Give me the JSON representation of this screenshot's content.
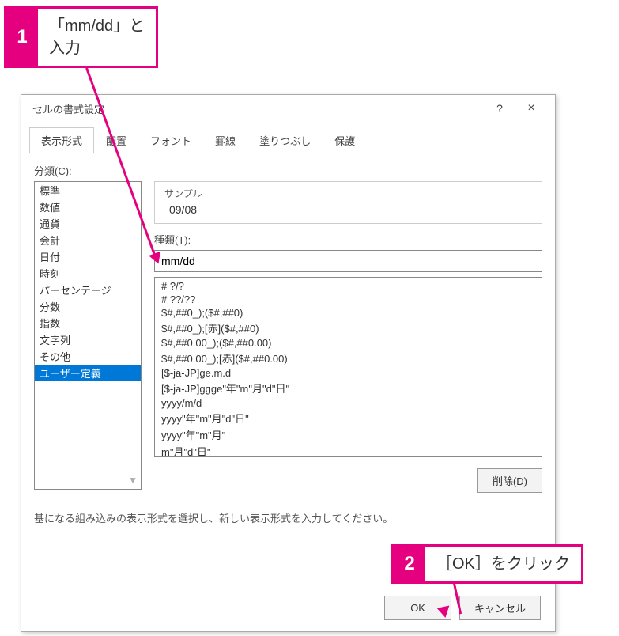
{
  "callouts": {
    "c1": {
      "num": "1",
      "text": "「mm/dd」と\n入力"
    },
    "c2": {
      "num": "2",
      "text": "［OK］をクリック"
    }
  },
  "dialog": {
    "title": "セルの書式設定",
    "help": "?",
    "close": "×",
    "tabs": [
      "表示形式",
      "配置",
      "フォント",
      "罫線",
      "塗りつぶし",
      "保護"
    ],
    "category_label": "分類(C):",
    "categories": [
      "標準",
      "数値",
      "通貨",
      "会計",
      "日付",
      "時刻",
      "パーセンテージ",
      "分数",
      "指数",
      "文字列",
      "その他",
      "ユーザー定義"
    ],
    "selected_category_index": 11,
    "sample_label": "サンプル",
    "sample_value": "09/08",
    "type_label": "種類(T):",
    "type_value": "mm/dd",
    "formats": [
      "# ?/?",
      "# ??/??",
      "$#,##0_);($#,##0)",
      "$#,##0_);[赤]($#,##0)",
      "$#,##0.00_);($#,##0.00)",
      "$#,##0.00_);[赤]($#,##0.00)",
      "[$-ja-JP]ge.m.d",
      "[$-ja-JP]ggge\"年\"m\"月\"d\"日\"",
      "yyyy/m/d",
      "yyyy\"年\"m\"月\"d\"日\"",
      "yyyy\"年\"m\"月\"",
      "m\"月\"d\"日\""
    ],
    "delete_label": "削除(D)",
    "hint": "基になる組み込みの表示形式を選択し、新しい表示形式を入力してください。",
    "ok_label": "OK",
    "cancel_label": "キャンセル"
  }
}
